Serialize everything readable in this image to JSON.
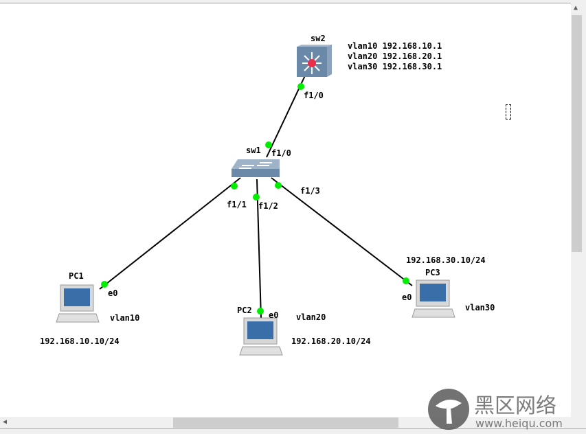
{
  "devices": {
    "sw2": {
      "name": "sw2",
      "config": [
        "vlan10 192.168.10.1",
        "vlan20 192.168.20.1",
        "vlan30 192.168.30.1"
      ],
      "port": "f1/0"
    },
    "sw1": {
      "name": "sw1",
      "ports": [
        "f1/0",
        "f1/1",
        "f1/2",
        "f1/3"
      ]
    },
    "pc1": {
      "name": "PC1",
      "port": "e0",
      "vlan": "vlan10",
      "ip": "192.168.10.10/24"
    },
    "pc2": {
      "name": "PC2",
      "port": "e0",
      "vlan": "vlan20",
      "ip": "192.168.20.10/24"
    },
    "pc3": {
      "name": "PC3",
      "port": "e0",
      "vlan": "vlan30",
      "ip": "192.168.30.10/24"
    }
  },
  "colors": {
    "link_dot": "#00ee00",
    "link": "#000000",
    "device": "#6a88a8"
  },
  "watermark": {
    "text": "黑区网络",
    "url": "www.heiqu.com"
  }
}
